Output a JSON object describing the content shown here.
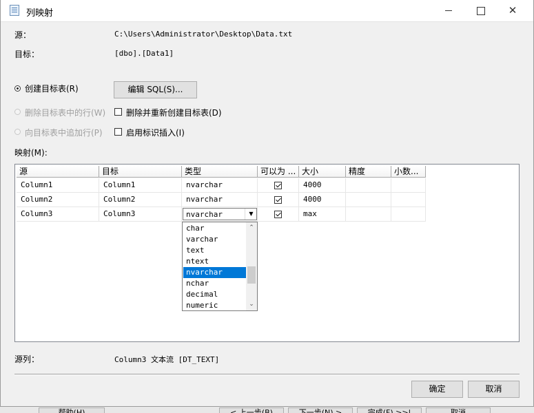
{
  "window": {
    "title": "列映射"
  },
  "info": {
    "source_label": "源：",
    "source_value": "C:\\Users\\Administrator\\Desktop\\Data.txt",
    "target_label": "目标：",
    "target_value": "[dbo].[Data1]"
  },
  "options": {
    "create_table": "创建目标表(R)",
    "edit_sql": "编辑 SQL(S)...",
    "delete_rows": "删除目标表中的行(W)",
    "drop_recreate": "删除并重新创建目标表(D)",
    "append_rows": "向目标表中追加行(P)",
    "identity_insert": "启用标识插入(I)"
  },
  "mapping_label": "映射(M):",
  "grid": {
    "columns": [
      "源",
      "目标",
      "类型",
      "可以为 ...",
      "大小",
      "精度",
      "小数..."
    ],
    "rows": [
      {
        "source": "Column1",
        "target": "Column1",
        "type": "nvarchar",
        "nullable": true,
        "size": "4000",
        "precision": "",
        "scale": ""
      },
      {
        "source": "Column2",
        "target": "Column2",
        "type": "nvarchar",
        "nullable": true,
        "size": "4000",
        "precision": "",
        "scale": ""
      },
      {
        "source": "Column3",
        "target": "Column3",
        "type": "nvarchar",
        "nullable": true,
        "size": "max",
        "precision": "",
        "scale": ""
      }
    ]
  },
  "type_dropdown": {
    "selected": "nvarchar",
    "options": [
      "char",
      "varchar",
      "text",
      "ntext",
      "nvarchar",
      "nchar",
      "decimal",
      "numeric"
    ]
  },
  "source_column": {
    "label": "源列：",
    "value": "Column3 文本流 [DT_TEXT]"
  },
  "buttons": {
    "ok": "确定",
    "cancel": "取消"
  },
  "background_wizard": {
    "help": "帮助(H)",
    "back": "< 上一步(B)",
    "next": "下一步(N) >",
    "finish": "完成(F) >>|",
    "cancel": "取消"
  }
}
